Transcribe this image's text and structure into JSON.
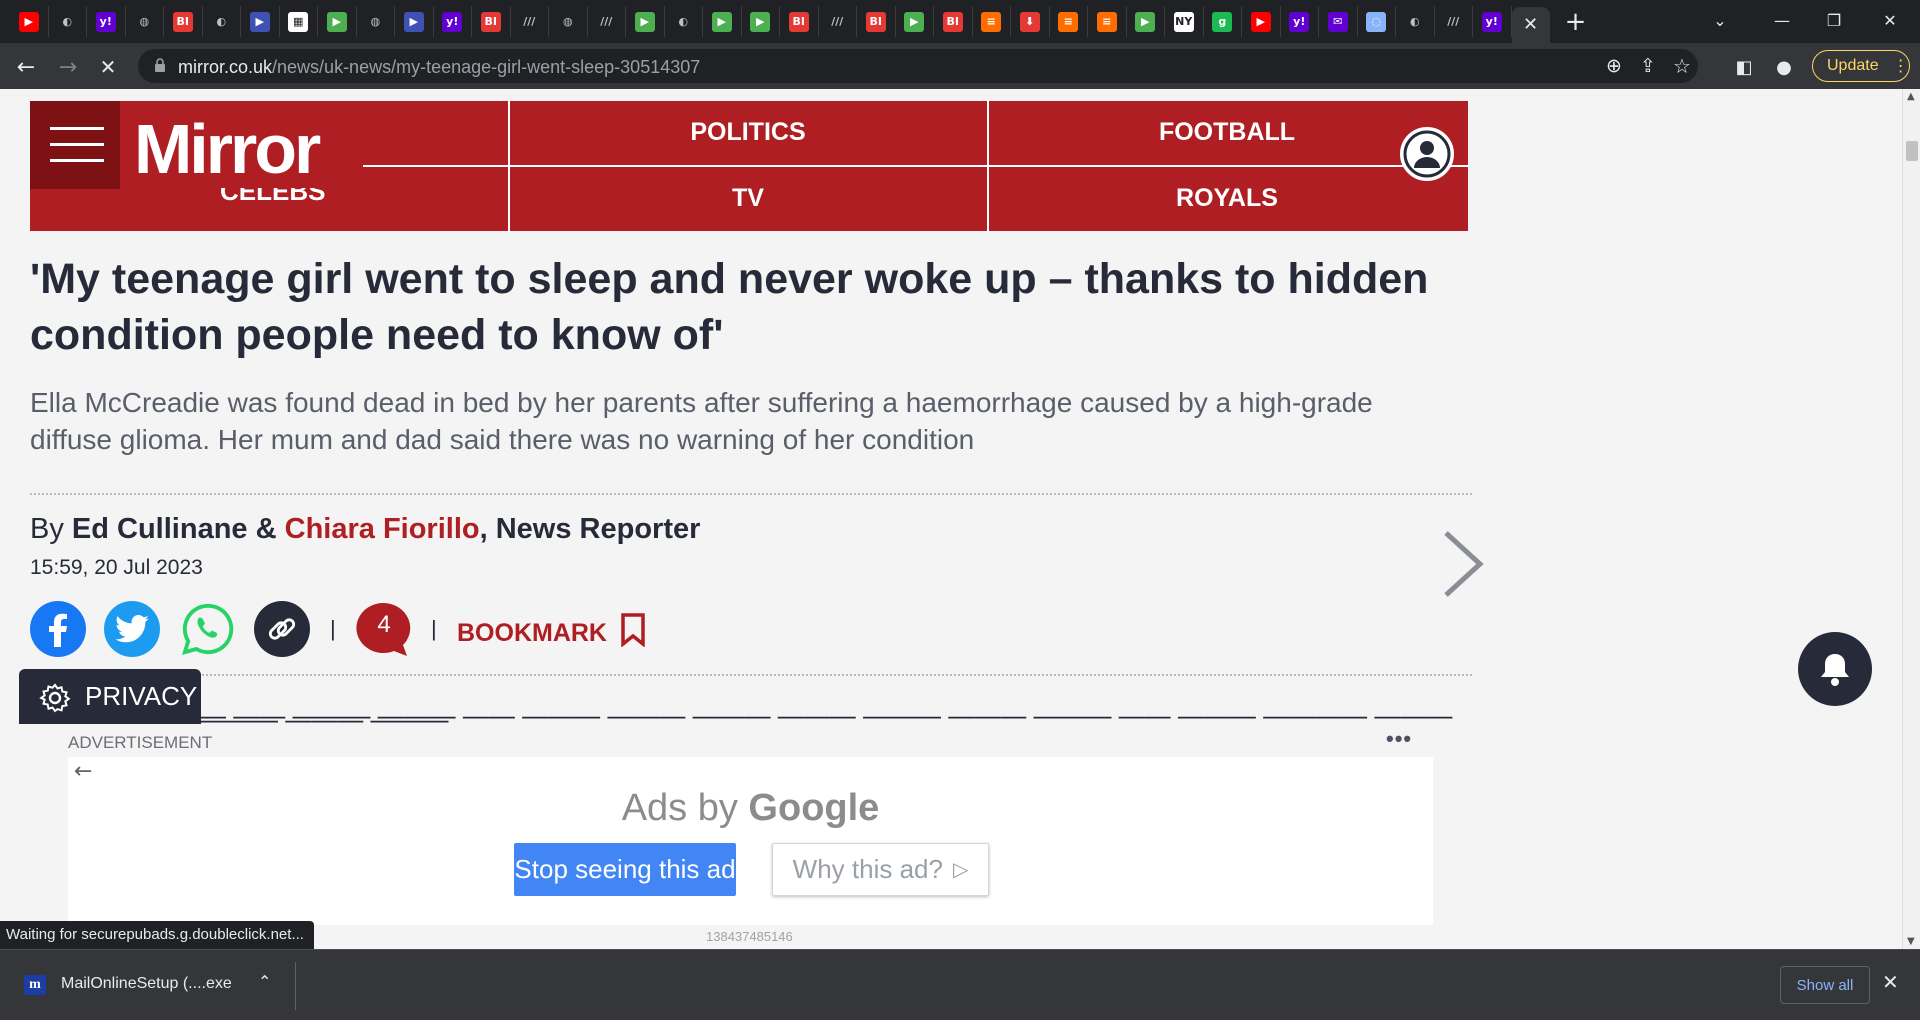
{
  "browser": {
    "tab_favicons": [
      {
        "icon": "youtube-icon",
        "color": "#ff0000",
        "glyph": "▶"
      },
      {
        "icon": "shield-icon",
        "color": "#202124",
        "glyph": "◐"
      },
      {
        "icon": "yahoo-icon",
        "color": "#6001d2",
        "glyph": "y!"
      },
      {
        "icon": "globe-icon",
        "color": "#202124",
        "glyph": "◍"
      },
      {
        "icon": "bi-icon",
        "color": "#e53935",
        "glyph": "BI"
      },
      {
        "icon": "shield-icon",
        "color": "#202124",
        "glyph": "◐"
      },
      {
        "icon": "arrow-icon",
        "color": "#3f51b5",
        "glyph": "▶"
      },
      {
        "icon": "sheets-icon",
        "color": "#ffffff",
        "glyph": "▦"
      },
      {
        "icon": "play-icon",
        "color": "#4caf50",
        "glyph": "▶"
      },
      {
        "icon": "globe-icon",
        "color": "#202124",
        "glyph": "◍"
      },
      {
        "icon": "arrow-icon",
        "color": "#3f51b5",
        "glyph": "▶"
      },
      {
        "icon": "yahoo-icon",
        "color": "#6001d2",
        "glyph": "y!"
      },
      {
        "icon": "bi-icon",
        "color": "#e53935",
        "glyph": "BI"
      },
      {
        "icon": "lines-icon",
        "color": "#202124",
        "glyph": "///"
      },
      {
        "icon": "globe-icon",
        "color": "#202124",
        "glyph": "◍"
      },
      {
        "icon": "lines-icon",
        "color": "#202124",
        "glyph": "///"
      },
      {
        "icon": "play-icon",
        "color": "#4caf50",
        "glyph": "▶"
      },
      {
        "icon": "shield-icon",
        "color": "#202124",
        "glyph": "◐"
      },
      {
        "icon": "play-icon",
        "color": "#4caf50",
        "glyph": "▶"
      },
      {
        "icon": "play-icon",
        "color": "#4caf50",
        "glyph": "▶"
      },
      {
        "icon": "bi-icon",
        "color": "#e53935",
        "glyph": "BI"
      },
      {
        "icon": "lines-icon",
        "color": "#202124",
        "glyph": "///"
      },
      {
        "icon": "bi-icon",
        "color": "#e53935",
        "glyph": "BI"
      },
      {
        "icon": "play-icon",
        "color": "#4caf50",
        "glyph": "▶"
      },
      {
        "icon": "bi-icon",
        "color": "#e53935",
        "glyph": "BI"
      },
      {
        "icon": "bookmark-icon",
        "color": "#ff6d00",
        "glyph": "≡"
      },
      {
        "icon": "download-icon",
        "color": "#e53935",
        "glyph": "⬇"
      },
      {
        "icon": "bookmark-icon",
        "color": "#ff6d00",
        "glyph": "≡"
      },
      {
        "icon": "bookmark-icon",
        "color": "#ff6d00",
        "glyph": "≡"
      },
      {
        "icon": "play-icon",
        "color": "#4caf50",
        "glyph": "▶"
      },
      {
        "icon": "news-icon",
        "color": "#ffffff",
        "glyph": "NY"
      },
      {
        "icon": "g-icon",
        "color": "#1db954",
        "glyph": "g"
      },
      {
        "icon": "youtube-icon",
        "color": "#ff0000",
        "glyph": "▶"
      },
      {
        "icon": "yahoo-icon",
        "color": "#6001d2",
        "glyph": "y!"
      },
      {
        "icon": "mail-icon",
        "color": "#6001d2",
        "glyph": "✉"
      },
      {
        "icon": "loading-icon",
        "color": "#8ab4f8",
        "glyph": "◌"
      },
      {
        "icon": "shield-icon",
        "color": "#202124",
        "glyph": "◐"
      },
      {
        "icon": "lines-icon",
        "color": "#202124",
        "glyph": "///"
      },
      {
        "icon": "yahoo-icon",
        "color": "#6001d2",
        "glyph": "y!"
      }
    ],
    "active_tab_close": "✕",
    "new_tab": "+",
    "url_domain": "mirror.co.uk",
    "url_path": "/news/uk-news/my-teenage-girl-went-sleep-30514307",
    "update_label": "Update"
  },
  "site": {
    "logo": "Mirror",
    "nav_partial": "CELEBS",
    "nav": [
      "POLITICS",
      "FOOTBALL",
      "TV",
      "ROYALS"
    ],
    "brand_color": "#ae1e22"
  },
  "article": {
    "headline": "'My teenage girl went to sleep and never woke up – thanks to hidden condition people need to know of'",
    "standfirst": "Ella McCreadie was found dead in bed by her parents after suffering a haemorrhage caused by a high-grade diffuse glioma. Her mum and dad said there was no warning of her condition",
    "by": "By",
    "author1": "Ed Cullinane",
    "amp": "&",
    "author2": "Chiara Fiorillo",
    "role": ", News Reporter",
    "date": "15:59, 20 Jul 2023",
    "comment_count": "4",
    "bookmark_label": "BOOKMARK",
    "sep": "|"
  },
  "privacy": {
    "label": "PRIVACY"
  },
  "ad": {
    "label": "ADVERTISEMENT",
    "more": "•••",
    "ads_by": "Ads by",
    "google": "Google",
    "stop_label": "Stop seeing this ad",
    "why_label": "Why this ad?",
    "ad_id": "138437485146"
  },
  "status_bar": "Waiting for securepubads.g.doubleclick.net...",
  "downloads": {
    "file_name": "MailOnlineSetup (....exe",
    "show_all": "Show all"
  }
}
